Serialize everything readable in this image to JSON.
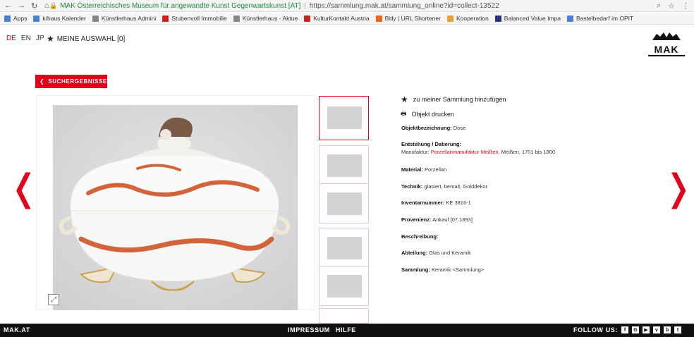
{
  "browser": {
    "tab_title": "MAK Österreichisches Museum für angewandte Kunst Gegenwartskunst [AT]",
    "url": "https://sammlung.mak.at/sammlung_online?id=collect-13522",
    "bookmarks": [
      {
        "label": "Apps",
        "color": "#4a7fd9"
      },
      {
        "label": "k/haus Kalender",
        "color": "#4a7fd9"
      },
      {
        "label": "Künstlerhaus Admini",
        "color": "#888888"
      },
      {
        "label": "Stubenvoll Immobilie",
        "color": "#d02020"
      },
      {
        "label": "Künstlerhaus - Aktue",
        "color": "#888888"
      },
      {
        "label": "KulturKontakt Austria",
        "color": "#cc2222"
      },
      {
        "label": "Bitly | URL Shortener",
        "color": "#ee6622"
      },
      {
        "label": "Kooperation",
        "color": "#f0a030"
      },
      {
        "label": "Balanced Value Impa",
        "color": "#223388"
      },
      {
        "label": "Bastelbedarf im OPIT",
        "color": "#4a7fd9"
      }
    ]
  },
  "header": {
    "languages": [
      "DE",
      "EN",
      "JP"
    ],
    "active_language": "DE",
    "meine_auswahl": "MEINE AUSWAHL [0]",
    "logo": "MAK"
  },
  "back_button": "SUCHERGEBNISSE",
  "actions": {
    "add": "zu meiner Sammlung hinzufügen",
    "print": "Objekt drucken"
  },
  "details": {
    "objektbezeichnung_label": "Objektbezeichnung:",
    "objektbezeichnung": "Dose",
    "entstehung_label": "Entstehung / Datierung:",
    "manufaktur_prefix": "Manufaktur:",
    "manufaktur_link": "Porzellanmanufaktur Meißen",
    "manufaktur_suffix": ", Meißen, 1701 bis 1800",
    "material_label": "Material:",
    "material": "Porzellan",
    "technik_label": "Technik:",
    "technik": "glasiert, bemalt, Golddekor",
    "inventar_label": "Inventarnummer:",
    "inventar": "KE 3816-1",
    "provenienz_label": "Provenienz:",
    "provenienz": "Ankauf [07.1893]",
    "beschreibung_label": "Beschreibung:",
    "abteilung_label": "Abteilung:",
    "abteilung": "Glas und Keramik",
    "sammlung_label": "Sammlung:",
    "sammlung": "Keramik <Sammlung>"
  },
  "footer": {
    "site": "MAK.AT",
    "impressum": "IMPRESSUM",
    "hilfe": "HILFE",
    "follow": "FOLLOW US:",
    "social": [
      "facebook-icon",
      "google-plus-icon",
      "youtube-icon",
      "vimeo-icon",
      "blog-icon",
      "twitter-icon"
    ]
  },
  "accent_color": "#e2001a"
}
